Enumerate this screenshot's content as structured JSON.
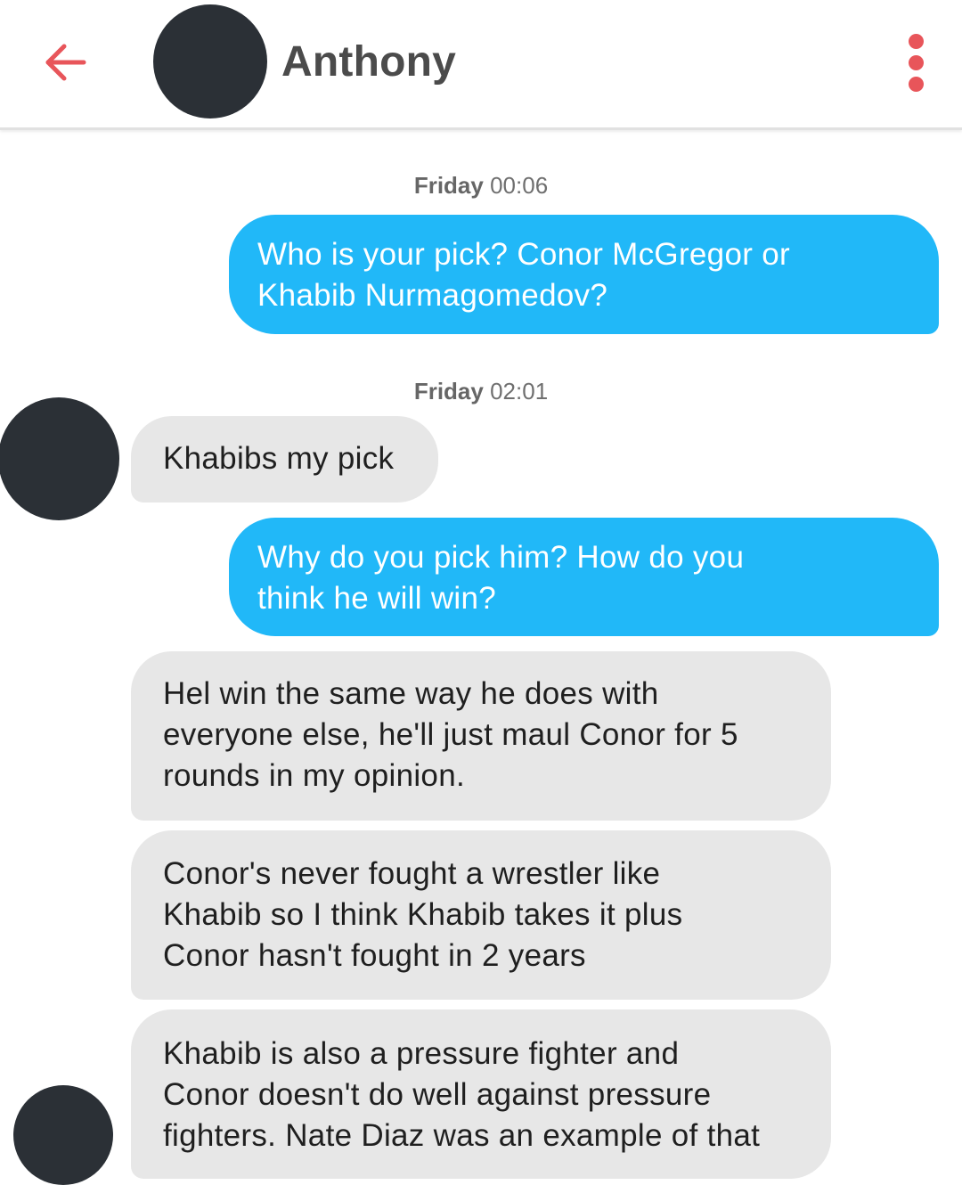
{
  "header": {
    "back_icon": "arrow-left-icon",
    "contact_name": "Anthony",
    "menu_icon": "vertical-dots-icon",
    "accent_color": "#e8555a"
  },
  "timestamps": [
    {
      "day": "Friday",
      "time": "00:06"
    },
    {
      "day": "Friday",
      "time": "02:01"
    }
  ],
  "messages": [
    {
      "direction": "sent",
      "lines": [
        "Who is your pick? Conor McGregor or",
        "Khabib Nurmagomedov?"
      ]
    },
    {
      "direction": "received",
      "lines": [
        "Khabibs my pick"
      ]
    },
    {
      "direction": "sent",
      "lines": [
        "Why do you pick him? How do you",
        "think he will win?"
      ]
    },
    {
      "direction": "received",
      "lines": [
        "Hel win the same way he does with",
        "everyone else, he'll just maul Conor for 5",
        "rounds in my opinion."
      ]
    },
    {
      "direction": "received",
      "lines": [
        "Conor's never fought a wrestler like",
        "Khabib so I think Khabib takes it plus",
        "Conor hasn't fought in 2 years"
      ]
    },
    {
      "direction": "received",
      "lines": [
        "Khabib is also a pressure fighter and",
        "Conor doesn't do well against pressure",
        "fighters. Nate Diaz was an example of that"
      ]
    }
  ],
  "colors": {
    "sent_bubble": "#21b8f8",
    "received_bubble": "#e7e7e7",
    "avatar_placeholder": "#2b3036"
  }
}
